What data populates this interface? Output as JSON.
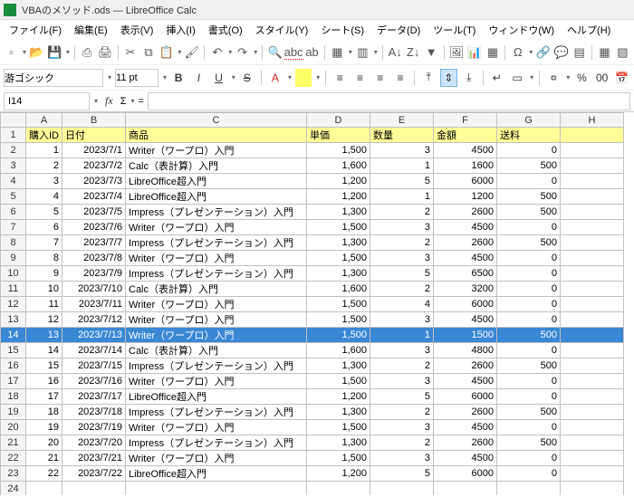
{
  "titlebar": {
    "title": "VBAのメソッド.ods — LibreOffice Calc"
  },
  "menu": {
    "file": "ファイル(F)",
    "edit": "編集(E)",
    "view": "表示(V)",
    "insert": "挿入(I)",
    "format": "書式(O)",
    "style": "スタイル(Y)",
    "sheet": "シート(S)",
    "data": "データ(D)",
    "tool": "ツール(T)",
    "window": "ウィンドウ(W)",
    "help": "ヘルプ(H)"
  },
  "format_bar": {
    "font_name": "游ゴシック",
    "font_size": "11 pt",
    "bold": "B",
    "italic": "I",
    "underline": "U",
    "strike": "S"
  },
  "namebox": {
    "cell_ref": "I14",
    "fx": "fx",
    "sigma": "Σ",
    "eq": "="
  },
  "sheet": {
    "col_letters": [
      "A",
      "B",
      "C",
      "D",
      "E",
      "F",
      "G",
      "H"
    ],
    "headers": [
      "購入ID",
      "日付",
      "商品",
      "単価",
      "数量",
      "金額",
      "送料"
    ],
    "selected_row": 14,
    "rows": [
      {
        "id": 1,
        "date": "2023/7/1",
        "item": "Writer（ワープロ）入門",
        "price": "1,500",
        "qty": 3,
        "amt": 4500,
        "ship": 0
      },
      {
        "id": 2,
        "date": "2023/7/2",
        "item": "Calc（表計算）入門",
        "price": "1,600",
        "qty": 1,
        "amt": 1600,
        "ship": 500
      },
      {
        "id": 3,
        "date": "2023/7/3",
        "item": "LibreOffice超入門",
        "price": "1,200",
        "qty": 5,
        "amt": 6000,
        "ship": 0
      },
      {
        "id": 4,
        "date": "2023/7/4",
        "item": "LibreOffice超入門",
        "price": "1,200",
        "qty": 1,
        "amt": 1200,
        "ship": 500
      },
      {
        "id": 5,
        "date": "2023/7/5",
        "item": "Impress（プレゼンテーション）入門",
        "price": "1,300",
        "qty": 2,
        "amt": 2600,
        "ship": 500
      },
      {
        "id": 6,
        "date": "2023/7/6",
        "item": "Writer（ワープロ）入門",
        "price": "1,500",
        "qty": 3,
        "amt": 4500,
        "ship": 0
      },
      {
        "id": 7,
        "date": "2023/7/7",
        "item": "Impress（プレゼンテーション）入門",
        "price": "1,300",
        "qty": 2,
        "amt": 2600,
        "ship": 500
      },
      {
        "id": 8,
        "date": "2023/7/8",
        "item": "Writer（ワープロ）入門",
        "price": "1,500",
        "qty": 3,
        "amt": 4500,
        "ship": 0
      },
      {
        "id": 9,
        "date": "2023/7/9",
        "item": "Impress（プレゼンテーション）入門",
        "price": "1,300",
        "qty": 5,
        "amt": 6500,
        "ship": 0
      },
      {
        "id": 10,
        "date": "2023/7/10",
        "item": "Calc（表計算）入門",
        "price": "1,600",
        "qty": 2,
        "amt": 3200,
        "ship": 0
      },
      {
        "id": 11,
        "date": "2023/7/11",
        "item": "Writer（ワープロ）入門",
        "price": "1,500",
        "qty": 4,
        "amt": 6000,
        "ship": 0
      },
      {
        "id": 12,
        "date": "2023/7/12",
        "item": "Writer（ワープロ）入門",
        "price": "1,500",
        "qty": 3,
        "amt": 4500,
        "ship": 0
      },
      {
        "id": 13,
        "date": "2023/7/13",
        "item": "Writer（ワープロ）入門",
        "price": "1,500",
        "qty": 1,
        "amt": 1500,
        "ship": 500
      },
      {
        "id": 14,
        "date": "2023/7/14",
        "item": "Calc（表計算）入門",
        "price": "1,600",
        "qty": 3,
        "amt": 4800,
        "ship": 0
      },
      {
        "id": 15,
        "date": "2023/7/15",
        "item": "Impress（プレゼンテーション）入門",
        "price": "1,300",
        "qty": 2,
        "amt": 2600,
        "ship": 500
      },
      {
        "id": 16,
        "date": "2023/7/16",
        "item": "Writer（ワープロ）入門",
        "price": "1,500",
        "qty": 3,
        "amt": 4500,
        "ship": 0
      },
      {
        "id": 17,
        "date": "2023/7/17",
        "item": "LibreOffice超入門",
        "price": "1,200",
        "qty": 5,
        "amt": 6000,
        "ship": 0
      },
      {
        "id": 18,
        "date": "2023/7/18",
        "item": "Impress（プレゼンテーション）入門",
        "price": "1,300",
        "qty": 2,
        "amt": 2600,
        "ship": 500
      },
      {
        "id": 19,
        "date": "2023/7/19",
        "item": "Writer（ワープロ）入門",
        "price": "1,500",
        "qty": 3,
        "amt": 4500,
        "ship": 0
      },
      {
        "id": 20,
        "date": "2023/7/20",
        "item": "Impress（プレゼンテーション）入門",
        "price": "1,300",
        "qty": 2,
        "amt": 2600,
        "ship": 500
      },
      {
        "id": 21,
        "date": "2023/7/21",
        "item": "Writer（ワープロ）入門",
        "price": "1,500",
        "qty": 3,
        "amt": 4500,
        "ship": 0
      },
      {
        "id": 22,
        "date": "2023/7/22",
        "item": "LibreOffice超入門",
        "price": "1,200",
        "qty": 5,
        "amt": 6000,
        "ship": 0
      }
    ]
  }
}
